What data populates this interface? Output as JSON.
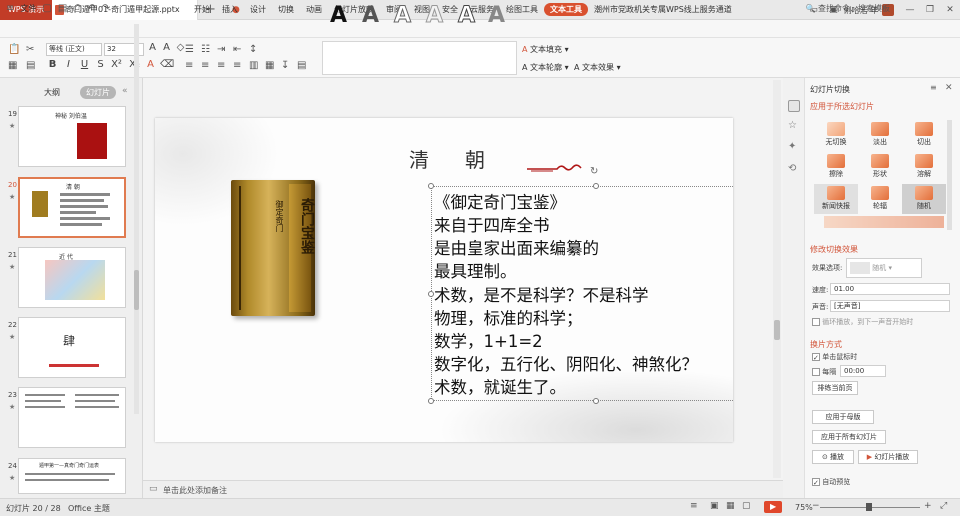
{
  "app": {
    "name": "WPS 演示",
    "user": "俐哈浩 年"
  },
  "document": {
    "tab_title": "奇门遁甲01-奇门遁甲起源.pptx"
  },
  "menu": {
    "file_label": "文件",
    "tabs": [
      "开始",
      "插入",
      "设计",
      "切换",
      "动画",
      "幻灯片放映",
      "审阅",
      "视图",
      "安全",
      "云服务",
      "绘图工具",
      "文本工具",
      "潮州市党政机关专属WPS线上服务通道"
    ],
    "active_tab": "文本工具",
    "search": "查找命令、搜索模板"
  },
  "toolbar": {
    "font_name": "等线 (正文)",
    "font_size": "32",
    "text_fill": "文本填充",
    "text_outline": "文本轮廓",
    "text_effect": "文本效果",
    "gallery_letter": "A"
  },
  "left_panel": {
    "tabs": [
      "大纲",
      "幻灯片"
    ],
    "active_tab": "幻灯片",
    "slides": [
      {
        "num": "19",
        "caption": "神秘    刘伯温"
      },
      {
        "num": "20",
        "caption": "清    朝",
        "selected": true
      },
      {
        "num": "21",
        "caption": "近    代"
      },
      {
        "num": "22",
        "caption": "肆"
      },
      {
        "num": "23",
        "caption": ""
      },
      {
        "num": "24",
        "caption": "遁甲第一—真奇门奇门运表"
      }
    ]
  },
  "slide": {
    "title": "清朝",
    "book_title": "奇门宝鉴",
    "book_subtitle": "御定奇门",
    "lines": [
      "《御定奇门宝鉴》",
      "来自于四库全书",
      "是由皇家出面来编纂的",
      "最具理制。",
      "术数，是不是科学？不是科学",
      "物理，标准的科学；",
      "数学，1+1=2",
      "数字化，五行化、阴阳化、神煞化？",
      "术数，就诞生了。"
    ]
  },
  "notes": {
    "placeholder": "单击此处添加备注"
  },
  "right_panel": {
    "title": "幻灯片切换",
    "apply_section": "应用于所选幻灯片",
    "transitions": [
      "无切换",
      "淡出",
      "切出",
      "擦除",
      "形状",
      "溶解",
      "新闻快报",
      "轮辐",
      "随机"
    ],
    "modify_section": "修改切换效果",
    "effect_label": "效果选项:",
    "effect_value": "随机",
    "speed_label": "速度:",
    "speed_value": "01.00",
    "sound_label": "声音:",
    "sound_value": "[无声音]",
    "loop_label": "循环播放，到下一声音开始时",
    "advance_section": "换片方式",
    "on_click_label": "单击鼠标时",
    "every_label": "每隔",
    "every_value": "00:00",
    "play_current": "排练当前页",
    "apply_master": "应用于母版",
    "apply_all": "应用于所有幻灯片",
    "play": "播放",
    "slideshow": "幻灯片播放",
    "auto_preview": "自动预览"
  },
  "status": {
    "slide_pos": "幻灯片 20 / 28",
    "theme": "Office 主题",
    "zoom": "75%"
  },
  "colors": {
    "accent": "#d2553a",
    "wps_red": "#c23c27"
  }
}
